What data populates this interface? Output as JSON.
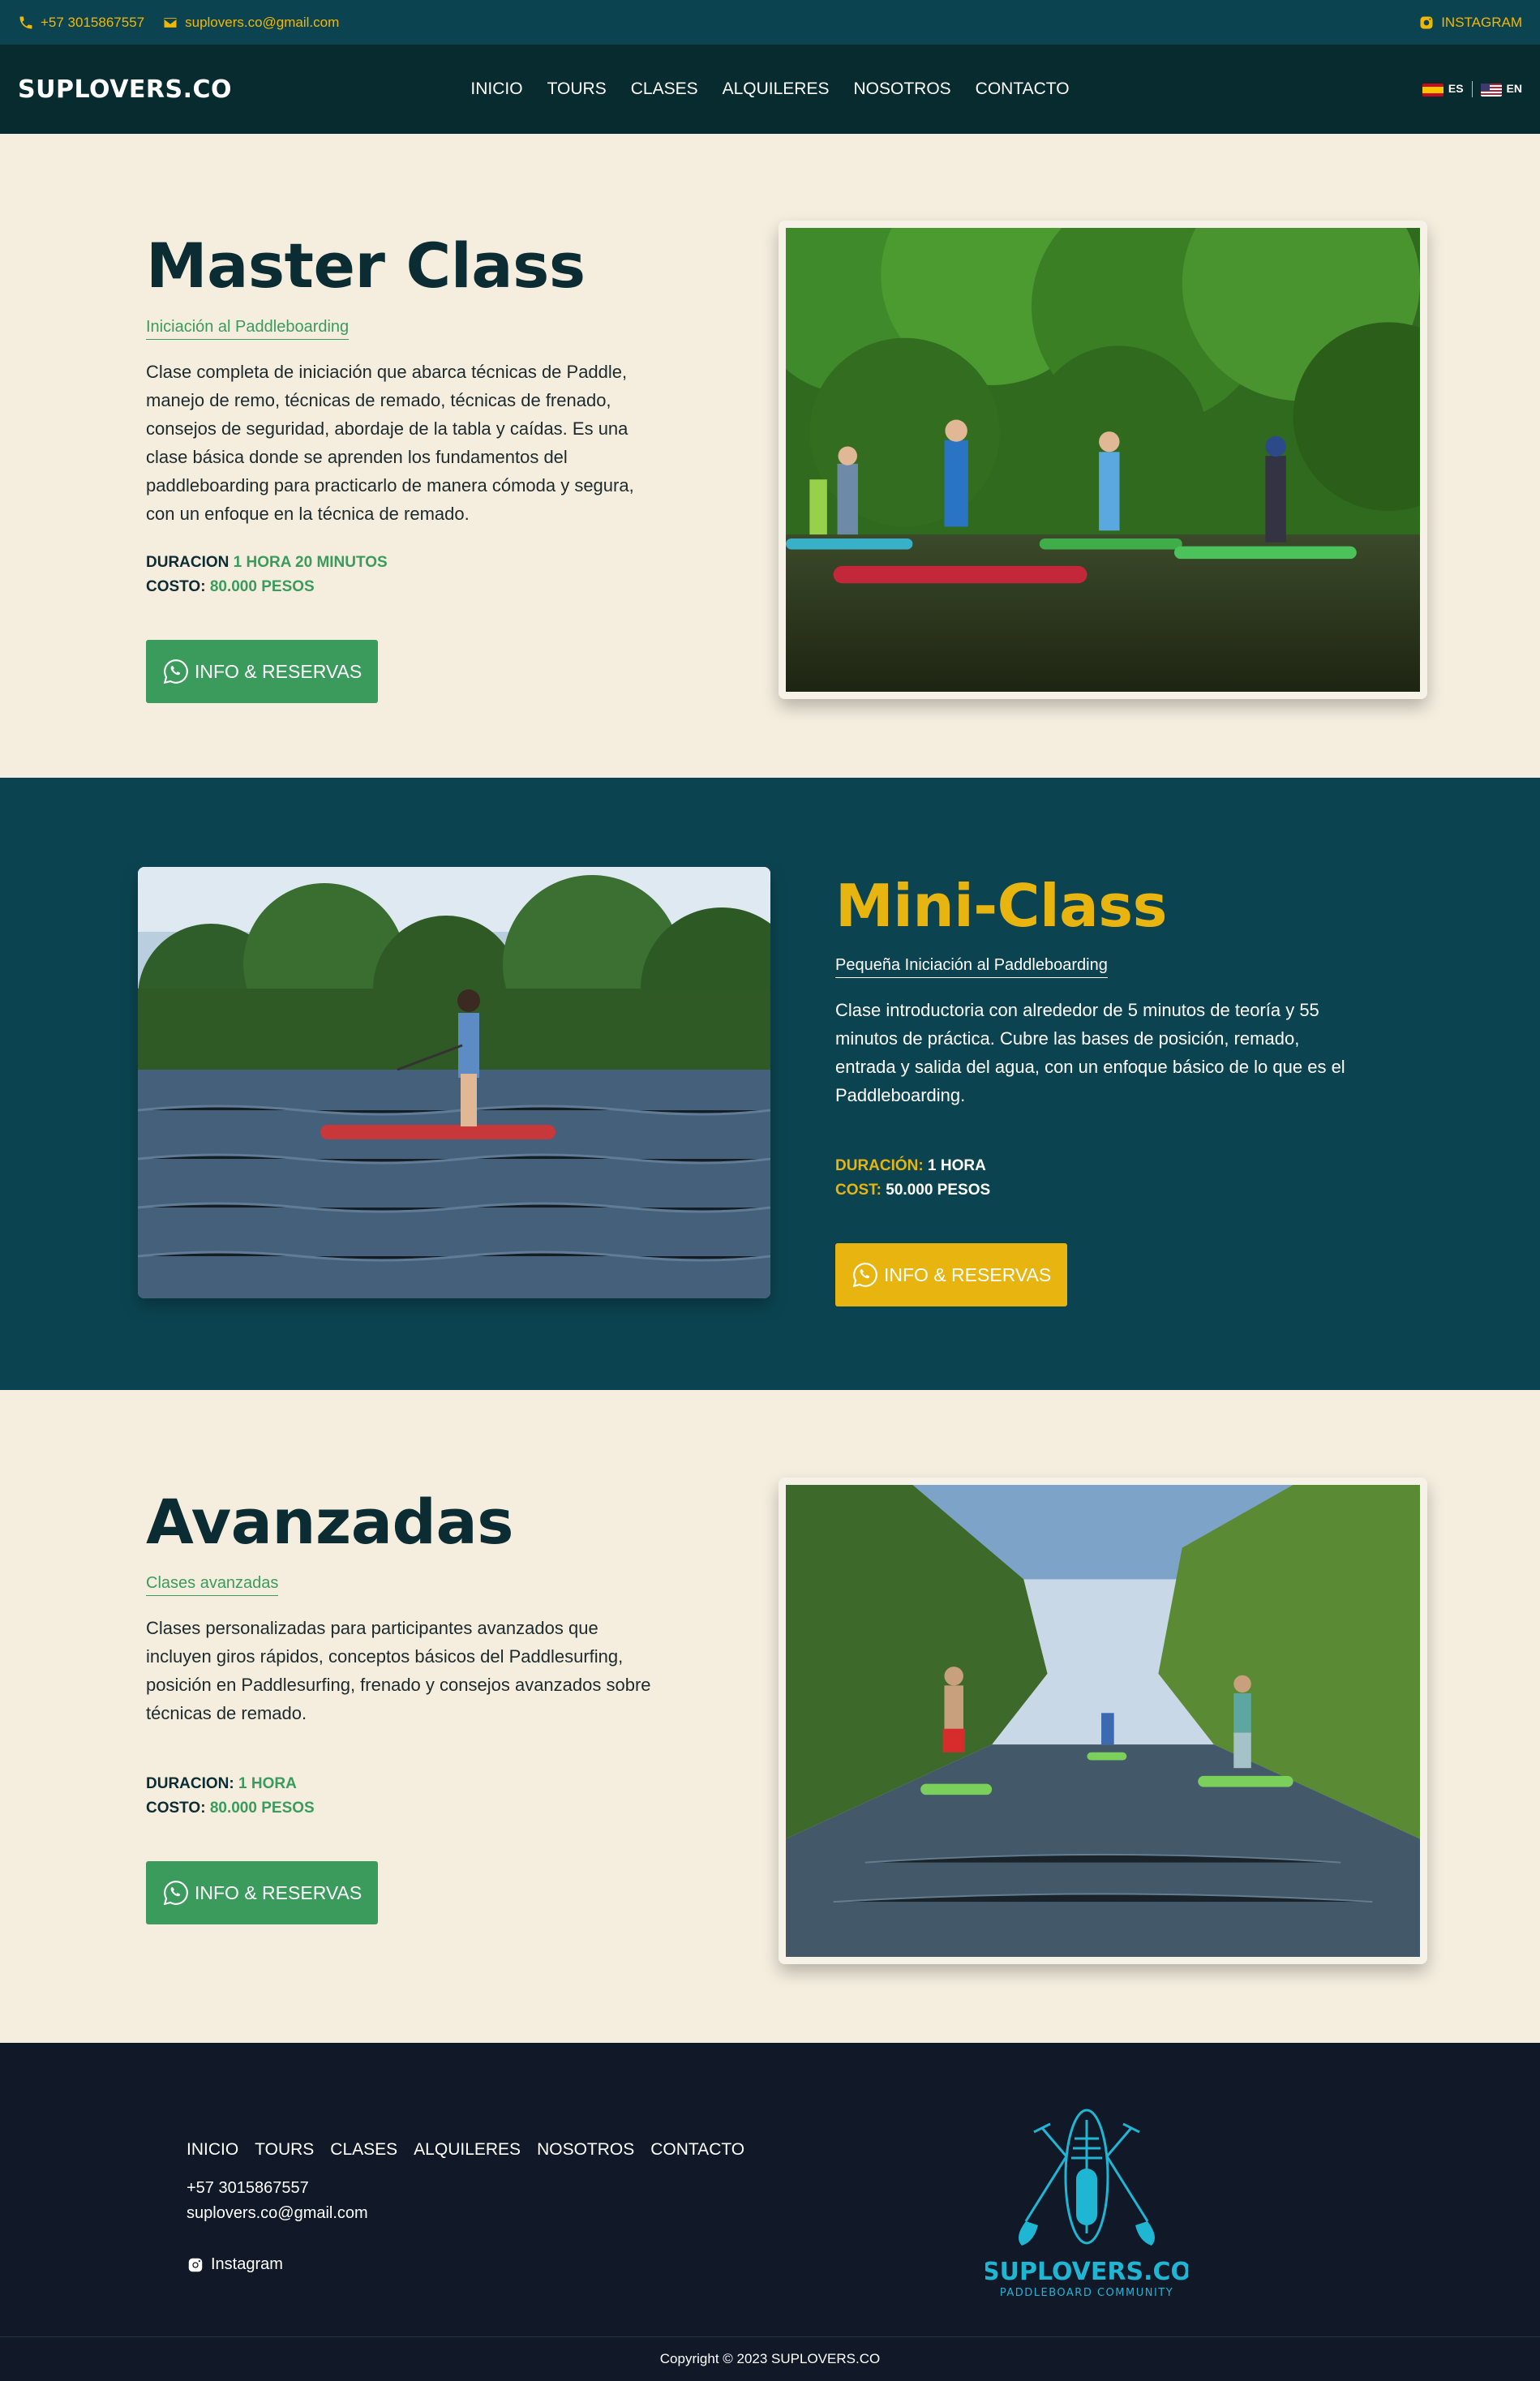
{
  "topbar": {
    "phone": "+57 3015867557",
    "email": "suplovers.co@gmail.com",
    "instagram": "INSTAGRAM"
  },
  "nav": {
    "brand": "SUPLOVERS.CO",
    "items": [
      "INICIO",
      "TOURS",
      "CLASES",
      "ALQUILERES",
      "NOSOTROS",
      "CONTACTO"
    ],
    "lang_es": "ES",
    "lang_en": "EN"
  },
  "classes": [
    {
      "title": "Master Class",
      "subtitle": "Iniciación al Paddleboarding",
      "description": "Clase completa de iniciación que abarca técnicas de Paddle, manejo de remo, técnicas de remado, técnicas de frenado, consejos de seguridad, abordaje de la tabla y caídas. Es una clase básica donde se aprenden los fundamentos del paddleboarding para practicarlo de manera cómoda y segura, con un enfoque en la técnica de remado.",
      "duration_label": "DURACION",
      "duration_value": "1 HORA 20 MINUTOS",
      "cost_label": "COSTO:",
      "cost_value": "80.000 PESOS",
      "button": "INFO & RESERVAS"
    },
    {
      "title": "Mini-Class",
      "subtitle": "Pequeña Iniciación al Paddleboarding",
      "description": "Clase introductoria con alrededor de 5 minutos de teoría y 55 minutos de práctica. Cubre las bases de posición, remado, entrada y salida del agua, con un enfoque básico de lo que es el Paddleboarding.",
      "duration_label": "DURACIÓN:",
      "duration_value": "1 HORA",
      "cost_label": "COST:",
      "cost_value": "50.000 PESOS",
      "button": "INFO & RESERVAS"
    },
    {
      "title": "Avanzadas",
      "subtitle": "Clases avanzadas",
      "description": "Clases personalizadas para participantes avanzados que incluyen giros rápidos, conceptos básicos del Paddlesurfing, posición en Paddlesurfing, frenado y consejos avanzados sobre técnicas de remado.",
      "duration_label": "DURACION:",
      "duration_value": "1 HORA",
      "cost_label": "COSTO:",
      "cost_value": "80.000 PESOS",
      "button": "INFO & RESERVAS"
    }
  ],
  "footer": {
    "menu": [
      "INICIO",
      "TOURS",
      "CLASES",
      "ALQUILERES",
      "NOSOTROS",
      "CONTACTO"
    ],
    "phone": "+57 3015867557",
    "email": "suplovers.co@gmail.com",
    "instagram": "Instagram",
    "logo_name": "SUPLOVERS.CO",
    "logo_tagline": "PADDLEBOARD COMMUNITY",
    "copyright": "Copyright © 2023 SUPLOVERS.CO"
  },
  "colors": {
    "dark_teal": "#0b4450",
    "navy": "#082b30",
    "cream": "#f5eedf",
    "green": "#3a9b5c",
    "yellow": "#e8b40f",
    "footer": "#111828",
    "logo_cyan": "#1fb6d4"
  }
}
